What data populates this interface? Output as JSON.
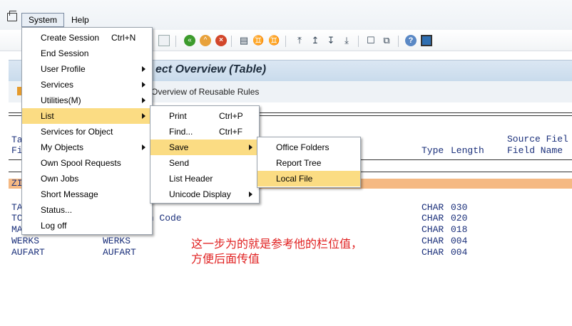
{
  "menubar": {
    "system_label": "System",
    "help_label": "Help"
  },
  "title": {
    "text": "ect Overview (Table)"
  },
  "app_toolbar": {
    "label": "Overview of Reusable Rules"
  },
  "list": {
    "header_left_1": "Ta",
    "header_left_2": "Fi",
    "header_type": "Type",
    "header_length": "Length",
    "header_source_1": "Source Fiel",
    "header_source_2": "Field Name",
    "highlight_prefix": "ZI",
    "rows": [
      {
        "c1": "TA",
        "c2": "e",
        "type": "CHAR",
        "len": "030"
      },
      {
        "c1": "TC",
        "c2": "on Code",
        "type": "CHAR",
        "len": "020"
      },
      {
        "c1": "MA",
        "c2": "",
        "type": "CHAR",
        "len": "018"
      },
      {
        "c1": "WERKS",
        "c2": "WERKS",
        "type": "CHAR",
        "len": "004"
      },
      {
        "c1": "AUFART",
        "c2": "AUFART",
        "type": "CHAR",
        "len": "004"
      }
    ]
  },
  "annotation": {
    "line1": "这一步为的就是参考他的栏位值，",
    "line2": "方便后面传值"
  },
  "system_menu": {
    "items": [
      {
        "label": "Create Session",
        "accel": "Ctrl+N"
      },
      {
        "label": "End Session",
        "accel": ""
      },
      {
        "label": "User Profile",
        "accel": ""
      },
      {
        "label": "Services",
        "accel": ""
      },
      {
        "label": "Utilities(M)",
        "accel": ""
      },
      {
        "label": "List",
        "accel": ""
      },
      {
        "label": "Services for Object",
        "accel": ""
      },
      {
        "label": "My Objects",
        "accel": ""
      },
      {
        "label": "Own Spool Requests",
        "accel": ""
      },
      {
        "label": "Own Jobs",
        "accel": ""
      },
      {
        "label": "Short Message",
        "accel": ""
      },
      {
        "label": "Status...",
        "accel": ""
      },
      {
        "label": "Log off",
        "accel": ""
      }
    ]
  },
  "list_menu": {
    "items": [
      {
        "label": "Print",
        "accel": "Ctrl+P"
      },
      {
        "label": "Find...",
        "accel": "Ctrl+F"
      },
      {
        "label": "Save",
        "accel": ""
      },
      {
        "label": "Send",
        "accel": ""
      },
      {
        "label": "List Header",
        "accel": ""
      },
      {
        "label": "Unicode Display",
        "accel": ""
      }
    ]
  },
  "save_menu": {
    "items": [
      {
        "label": "Office Folders"
      },
      {
        "label": "Report Tree"
      },
      {
        "label": "Local File"
      }
    ]
  },
  "colors": {
    "menu_highlight": "#fbdc83",
    "row_highlight": "#f5b983",
    "annotation": "#e02020",
    "list_text": "#1a2f7a"
  }
}
